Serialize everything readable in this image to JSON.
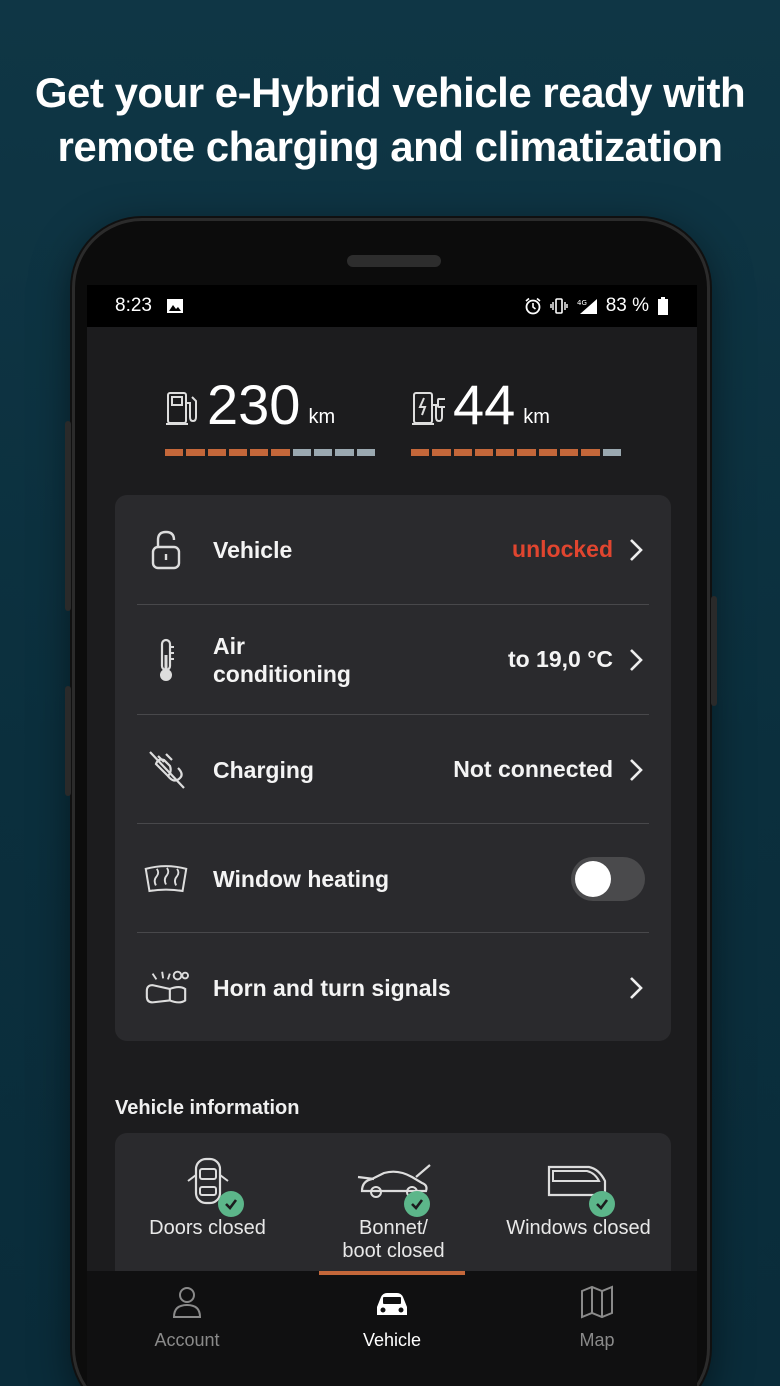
{
  "headline": {
    "line1": "Get your e-Hybrid vehicle ready with",
    "line2": "remote charging and climatization"
  },
  "status_bar": {
    "time": "8:23",
    "network": "4G",
    "battery": "83 %"
  },
  "ranges": [
    {
      "icon": "fuel-pump-icon",
      "value": "230",
      "unit": "km",
      "level": 0.6
    },
    {
      "icon": "charging-station-icon",
      "value": "44",
      "unit": "km",
      "level": 0.9
    }
  ],
  "colors": {
    "accent": "#c4673a",
    "bar_empty": "#9aa8b0",
    "danger": "#e0452f",
    "success": "#5cb68a"
  },
  "controls": {
    "vehicle": {
      "label": "Vehicle",
      "status": "unlocked"
    },
    "air_conditioning": {
      "label_line1": "Air",
      "label_line2": "conditioning",
      "status": "to 19,0 °C"
    },
    "charging": {
      "label": "Charging",
      "status": "Not connected"
    },
    "window_heating": {
      "label": "Window heating",
      "enabled": false
    },
    "horn": {
      "label": "Horn and turn signals"
    }
  },
  "vehicle_information": {
    "title": "Vehicle information",
    "items": [
      {
        "icon": "car-doors-icon",
        "label": "Doors closed"
      },
      {
        "icon": "car-bonnet-icon",
        "label_line1": "Bonnet/",
        "label_line2": "boot closed"
      },
      {
        "icon": "car-window-icon",
        "label": "Windows closed"
      }
    ]
  },
  "tabs": [
    {
      "icon": "person-icon",
      "label": "Account",
      "active": false
    },
    {
      "icon": "car-icon",
      "label": "Vehicle",
      "active": true
    },
    {
      "icon": "map-icon",
      "label": "Map",
      "active": false
    }
  ]
}
